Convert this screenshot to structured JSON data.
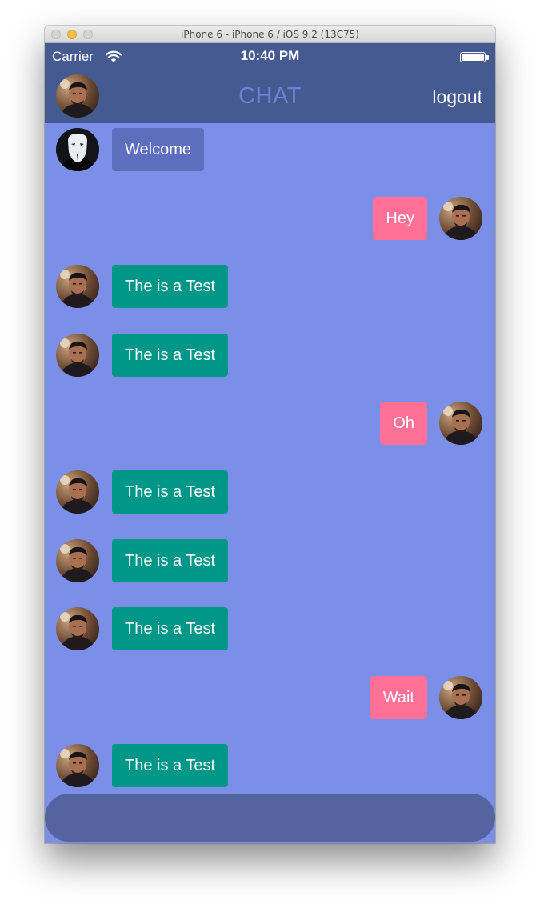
{
  "window": {
    "title": "iPhone 6 - iPhone 6 / iOS 9.2 (13C75)"
  },
  "statusbar": {
    "carrier": "Carrier",
    "time": "10:40 PM",
    "battery_level": 1.0
  },
  "navbar": {
    "title": "CHAT",
    "logout_label": "logout"
  },
  "colors": {
    "nav": "#465a92",
    "chat_background": "#7b8ee8",
    "welcome_bubble": "#5d6ebf",
    "incoming_bubble": "#009688",
    "outgoing_bubble": "#ff7096",
    "composer": "#5464a0"
  },
  "messages": [
    {
      "text": "Welcome",
      "side": "in",
      "avatar": "mask-avatar",
      "color": "#5d6ebf"
    },
    {
      "text": "Hey",
      "side": "out",
      "avatar": "user-avatar",
      "color": "#ff7096"
    },
    {
      "text": "The is a Test",
      "side": "in",
      "avatar": "user-avatar",
      "color": "#009688"
    },
    {
      "text": "The is a Test",
      "side": "in",
      "avatar": "user-avatar",
      "color": "#009688"
    },
    {
      "text": "Oh",
      "side": "out",
      "avatar": "user-avatar",
      "color": "#ff7096"
    },
    {
      "text": "The is a Test",
      "side": "in",
      "avatar": "user-avatar",
      "color": "#009688"
    },
    {
      "text": "The is a Test",
      "side": "in",
      "avatar": "user-avatar",
      "color": "#009688"
    },
    {
      "text": "The is a Test",
      "side": "in",
      "avatar": "user-avatar",
      "color": "#009688"
    },
    {
      "text": "Wait",
      "side": "out",
      "avatar": "user-avatar",
      "color": "#ff7096"
    },
    {
      "text": "The is a Test",
      "side": "in",
      "avatar": "user-avatar",
      "color": "#009688"
    }
  ],
  "composer": {
    "placeholder": ""
  }
}
